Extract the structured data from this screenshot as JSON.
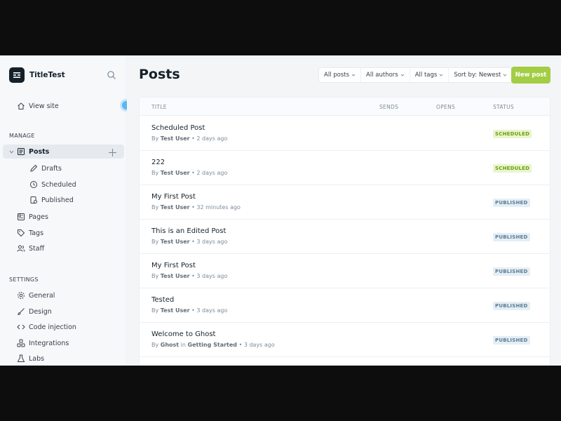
{
  "sidebar": {
    "brand": "TitleTest",
    "view_site": "View site",
    "manage_label": "MANAGE",
    "posts": "Posts",
    "drafts": "Drafts",
    "scheduled": "Scheduled",
    "published": "Published",
    "pages": "Pages",
    "tags": "Tags",
    "staff": "Staff",
    "settings_label": "SETTINGS",
    "general": "General",
    "design": "Design",
    "code_injection": "Code injection",
    "integrations": "Integrations",
    "labs": "Labs"
  },
  "header": {
    "title": "Posts",
    "filters": [
      "All posts",
      "All authors",
      "All tags",
      "Sort by: Newest"
    ],
    "new_post": "New post"
  },
  "table": {
    "columns": [
      "TITLE",
      "SENDS",
      "OPENS",
      "STATUS"
    ],
    "rows": [
      {
        "title": "Scheduled Post",
        "by": "By",
        "author": "Test User",
        "in": "",
        "tag": "",
        "time": "• 2 days ago",
        "status": "SCHEDULED"
      },
      {
        "title": "222",
        "by": "By",
        "author": "Test User",
        "in": "",
        "tag": "",
        "time": "• 2 days ago",
        "status": "SCHEDULED"
      },
      {
        "title": "My First Post",
        "by": "By",
        "author": "Test User",
        "in": "",
        "tag": "",
        "time": "• 32 minutes ago",
        "status": "PUBLISHED"
      },
      {
        "title": "This is an Edited Post",
        "by": "By",
        "author": "Test User",
        "in": "",
        "tag": "",
        "time": "• 3 days ago",
        "status": "PUBLISHED"
      },
      {
        "title": "My First Post",
        "by": "By",
        "author": "Test User",
        "in": "",
        "tag": "",
        "time": "• 3 days ago",
        "status": "PUBLISHED"
      },
      {
        "title": "Tested",
        "by": "By",
        "author": "Test User",
        "in": "",
        "tag": "",
        "time": "• 3 days ago",
        "status": "PUBLISHED"
      },
      {
        "title": "Welcome to Ghost",
        "by": "By",
        "author": "Ghost",
        "in": "in",
        "tag": "Getting Started",
        "time": "• 3 days ago",
        "status": "PUBLISHED"
      }
    ]
  },
  "colors": {
    "accent": "#a3cd44",
    "scheduled": "#6f9b13",
    "published": "#5a7d96"
  }
}
